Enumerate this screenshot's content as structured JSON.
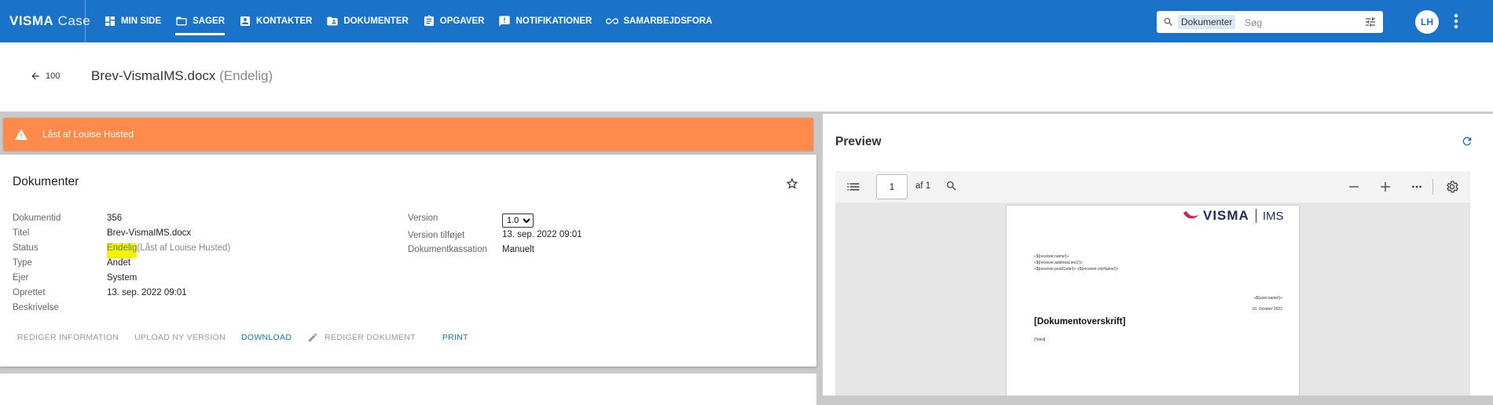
{
  "app": {
    "brand_bold": "VISMA",
    "brand_light": "Case"
  },
  "nav": [
    {
      "label": "MIN SIDE",
      "icon": "dashboard-icon"
    },
    {
      "label": "SAGER",
      "icon": "folder-icon",
      "active": true
    },
    {
      "label": "KONTAKTER",
      "icon": "contact-card-icon"
    },
    {
      "label": "DOKUMENTER",
      "icon": "folder-user-icon"
    },
    {
      "label": "OPGAVER",
      "icon": "clipboard-icon"
    },
    {
      "label": "NOTIFIKATIONER",
      "icon": "announcement-icon"
    },
    {
      "label": "SAMARBEJDSFORA",
      "icon": "link-icon"
    }
  ],
  "search": {
    "scope": "Dokumenter",
    "placeholder": "Søg"
  },
  "user": {
    "initials": "LH"
  },
  "header": {
    "back_label": "100",
    "title": "Brev-VismaIMS.docx",
    "title_status": "(Endelig)"
  },
  "alert": {
    "text": "Låst af Louise Husted",
    "color": "#ff8a4c"
  },
  "documents": {
    "heading": "Dokumenter",
    "left": {
      "id_label": "Dokumentid",
      "id_value": "356",
      "title_label": "Titel",
      "title_value": "Brev-VismaIMS.docx",
      "status_label": "Status",
      "status_value": "Endelig",
      "status_extra": " (Låst af Louise Husted)",
      "type_label": "Type",
      "type_value": "Andet",
      "owner_label": "Ejer",
      "owner_value": "System",
      "created_label": "Oprettet",
      "created_value": "13. sep. 2022 09:01",
      "desc_label": "Beskrivelse",
      "desc_value": ""
    },
    "right": {
      "version_label": "Version",
      "version_value": "1.0",
      "version_added_label": "Version tilføjet",
      "version_added_value": "13. sep. 2022 09:01",
      "cassation_label": "Dokumentkassation",
      "cassation_value": "Manuelt"
    },
    "actions": {
      "edit_info": "REDIGÉR INFORMATION",
      "upload": "UPLOAD NY VERSION",
      "download": "DOWNLOAD",
      "edit_doc": "REDIGÉR DOKUMENT",
      "print": "PRINT"
    }
  },
  "preview": {
    "heading": "Preview",
    "page_number": "1",
    "page_total": "af 1",
    "doc": {
      "logo_left": "VISMA",
      "logo_right": "IMS",
      "addr1": "«${receiver.name!}»",
      "addr2": "«${receiver.addressLine1!}»",
      "addr3": "«${receiver.postCode!}» «${receiver.cityName!}»",
      "user": "«${user.name!}»",
      "date": "10. October 2022",
      "heading": "[Dokumentoverskrift]",
      "body": "[Tekst]"
    }
  },
  "colors": {
    "brand_blue": "#1a73c8",
    "link_blue": "#1a6fc0",
    "highlight": "#f2f500"
  }
}
